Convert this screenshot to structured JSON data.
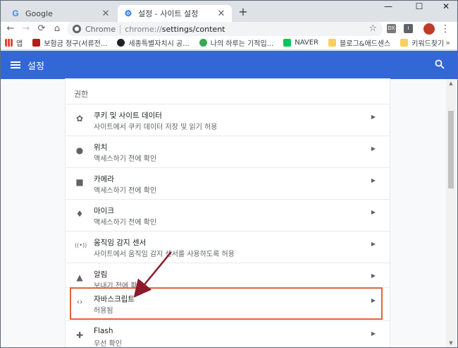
{
  "tabs": [
    {
      "title": "Google",
      "favicon": "G",
      "favicon_color": "#4285f4",
      "active": false
    },
    {
      "title": "설정 - 사이트 설정",
      "favicon": "gear-icon",
      "favicon_color": "#1a73e8",
      "active": true
    }
  ],
  "window_controls": {
    "minimize": "—",
    "maximize": "☐",
    "close": "✕"
  },
  "toolbar": {
    "back": "←",
    "forward": "→",
    "reload": "⟳",
    "home": "⌂",
    "site_chip": "Chrome",
    "url_scheme": "chrome://",
    "url_path": "settings/content",
    "star": "☆",
    "ext1": "DX",
    "ext2": "I",
    "menu": "⋮"
  },
  "bookmarks": [
    {
      "label": "앱",
      "icon_color": "#ea4335"
    },
    {
      "label": "보험금 청구(서류전...",
      "icon_color": "#b71c1c"
    },
    {
      "label": "세종특별자치시 공...",
      "icon_color": "#202124"
    },
    {
      "label": "나의 하루는 기적입...",
      "icon_color": "#34a853"
    },
    {
      "label": "NAVER",
      "icon_color": "#03c75a"
    },
    {
      "label": "블로그&애드센스",
      "icon_color": "#f9cf5b"
    },
    {
      "label": "키워드찾기",
      "icon_color": "#f9cf5b"
    }
  ],
  "bookmarks_more": "»",
  "header": {
    "title": "설정",
    "search_icon": "search-icon"
  },
  "section": {
    "title": "권한"
  },
  "rows": [
    {
      "name": "cookies",
      "icon": "cookie-icon",
      "glyph": "✿",
      "title": "쿠키 및 사이트 데이터",
      "subtitle": "사이트에서 쿠키 데이터 저장 및 읽기 허용"
    },
    {
      "name": "location",
      "icon": "location-pin-icon",
      "glyph": "●",
      "title": "위치",
      "subtitle": "액세스하기 전에 확인"
    },
    {
      "name": "camera",
      "icon": "camera-icon",
      "glyph": "■",
      "title": "카메라",
      "subtitle": "액세스하기 전에 확인"
    },
    {
      "name": "microphone",
      "icon": "microphone-icon",
      "glyph": "♦",
      "title": "마이크",
      "subtitle": "액세스하기 전에 확인"
    },
    {
      "name": "motion-sensors",
      "icon": "motion-sensor-icon",
      "glyph": "((•))",
      "title": "움직임 감지 센서",
      "subtitle": "사이트에서 움직임 감지 센서를 사용하도록 허용"
    },
    {
      "name": "notifications",
      "icon": "bell-icon",
      "glyph": "▲",
      "title": "알림",
      "subtitle": "보내기 전에 확인"
    },
    {
      "name": "javascript",
      "icon": "code-icon",
      "glyph": "‹›",
      "title": "자바스크립트",
      "subtitle": "허용됨"
    },
    {
      "name": "flash",
      "icon": "puzzle-icon",
      "glyph": "✚",
      "title": "Flash",
      "subtitle": "우선 확인"
    }
  ],
  "row_arrow": "▶",
  "colors": {
    "header_blue": "#3367d6",
    "highlight": "#e0633c",
    "arrow": "#8b1a2b"
  }
}
